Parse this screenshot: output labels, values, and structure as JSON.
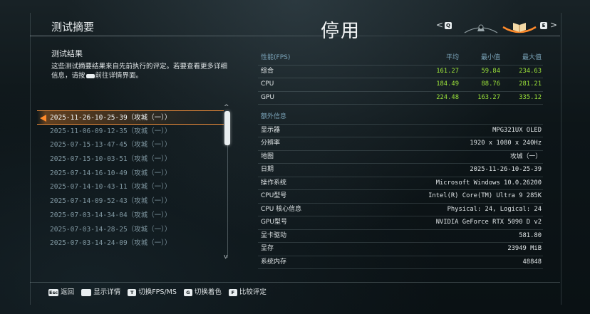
{
  "header": {
    "page_title": "测试摘要",
    "overlay_title": "停用",
    "tab_left_key": "Q",
    "tab_right_key": "E"
  },
  "left": {
    "heading": "测试结果",
    "description_before": "这些测试摘要结果来自先前执行的评定。若要查看更多详细信息，请按",
    "description_after": "前往详情界面。",
    "records": [
      "2025-11-26-10-25-39（攻城（一））",
      "2025-11-06-09-12-35（攻城（一））",
      "2025-07-15-13-47-45（攻城（一））",
      "2025-07-15-10-03-51（攻城（一））",
      "2025-07-14-16-10-49（攻城（一））",
      "2025-07-14-10-43-11（攻城（一））",
      "2025-07-14-09-52-43（攻城（一））",
      "2025-07-03-14-34-04（攻城（一））",
      "2025-07-03-14-28-25（攻城（一））",
      "2025-07-03-14-24-09（攻城（一））"
    ],
    "selected_index": 0
  },
  "performance": {
    "header_label": "性能(FPS)",
    "columns": [
      "平均",
      "最小值",
      "最大值"
    ],
    "rows": [
      {
        "label": "综合",
        "values": [
          "161.27",
          "59.84",
          "234.63"
        ]
      },
      {
        "label": "CPU",
        "values": [
          "184.49",
          "88.76",
          "281.21"
        ]
      },
      {
        "label": "GPU",
        "values": [
          "224.48",
          "163.27",
          "335.12"
        ]
      }
    ],
    "value_color": "#9be23a"
  },
  "extra": {
    "header_label": "额外信息",
    "rows": [
      {
        "label": "显示器",
        "value": "MPG321UX OLED"
      },
      {
        "label": "分辨率",
        "value": "1920 x 1080 x 240Hz"
      },
      {
        "label": "地图",
        "value": "攻城（一）"
      },
      {
        "label": "日期",
        "value": "2025-11-26-10-25-39"
      },
      {
        "label": "操作系统",
        "value": "Microsoft Windows 10.0.26200"
      },
      {
        "label": "CPU型号",
        "value": "Intel(R) Core(TM) Ultra 9 285K"
      },
      {
        "label": "CPU 核心信息",
        "value": "Physical: 24, Logical: 24"
      },
      {
        "label": "GPU型号",
        "value": "NVIDIA GeForce RTX 5090 D v2"
      },
      {
        "label": "显卡驱动",
        "value": "581.80"
      },
      {
        "label": "显存",
        "value": "23949 MiB"
      },
      {
        "label": "系统内存",
        "value": "48848"
      }
    ]
  },
  "footer": {
    "hints": [
      {
        "key": "Esc",
        "label": "返回"
      },
      {
        "key": "",
        "label": "显示详情"
      },
      {
        "key": "T",
        "label": "切换FPS/MS"
      },
      {
        "key": "G",
        "label": "切换着色"
      },
      {
        "key": "F",
        "label": "比较评定"
      }
    ]
  },
  "colors": {
    "accent": "#ff8a2a",
    "header_blue": "#7aa3b8",
    "selected_text": "#f1f4f5",
    "record_text": "#7f96a0"
  },
  "icons": {
    "tab_left_arrow": "chevron-left-icon",
    "tab_right_arrow": "chevron-right-icon",
    "tab_inactive": "helmet-icon",
    "tab_active": "open-book-icon"
  }
}
